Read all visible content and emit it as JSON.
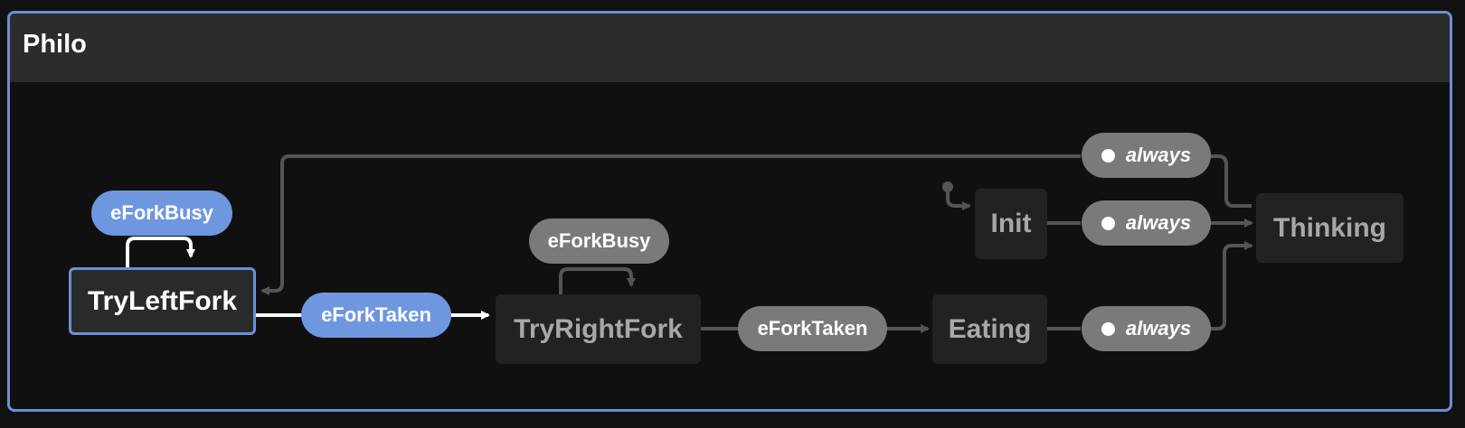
{
  "machine": {
    "title": "Philo"
  },
  "states": {
    "try_left_fork": "TryLeftFork",
    "try_right_fork": "TryRightFork",
    "eating": "Eating",
    "init": "Init",
    "thinking": "Thinking"
  },
  "events": {
    "left_busy": "eForkBusy",
    "left_taken": "eForkTaken",
    "right_busy": "eForkBusy",
    "right_taken": "eForkTaken",
    "always_top": "always",
    "always_init": "always",
    "always_eating": "always"
  },
  "colors": {
    "accent": "#6b8fd6",
    "active_event": "#6f97e0",
    "inactive_event": "#7a7a7a",
    "state_bg": "#222222",
    "background": "#111111"
  }
}
